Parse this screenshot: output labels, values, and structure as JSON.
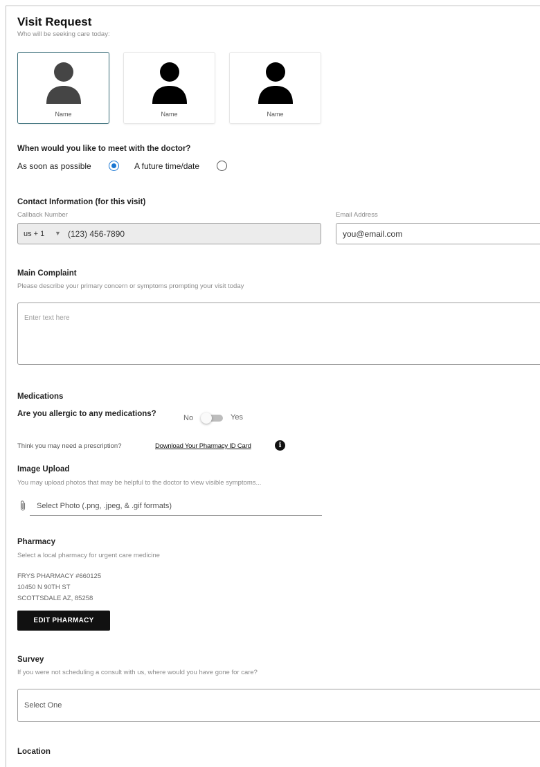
{
  "header": {
    "title": "Visit Request",
    "subtitle": "Who will be seeking care today:"
  },
  "patients": [
    {
      "name": "Name",
      "selected": true
    },
    {
      "name": "Name",
      "selected": false
    },
    {
      "name": "Name",
      "selected": false
    }
  ],
  "timing": {
    "question": "When would you like to meet with the doctor?",
    "option_asap": "As soon as possible",
    "option_future": "A future time/date",
    "selected": "asap"
  },
  "contact": {
    "heading": "Contact Information (for this visit)",
    "callback_label": "Callback Number",
    "country_code": "us + 1",
    "phone_value": "(123) 456-7890",
    "email_label": "Email Address",
    "email_value": "you@email.com"
  },
  "complaint": {
    "heading": "Main Complaint",
    "description": "Please describe your primary concern or symptoms prompting your visit today",
    "placeholder": "Enter text here"
  },
  "medications": {
    "heading": "Medications",
    "allergy_question": "Are you allergic to any medications?",
    "toggle_off_label": "No",
    "toggle_on_label": "Yes",
    "prescription_prompt": "Think you may need a prescription?",
    "pharmacy_card_link": "Download Your Pharmacy ID Card",
    "info_glyph": "i"
  },
  "image_upload": {
    "heading": "Image Upload",
    "description": "You may upload photos that may be helpful to the doctor to view visible symptoms...",
    "placeholder": "Select Photo (.png, .jpeg, & .gif formats)"
  },
  "pharmacy": {
    "heading": "Pharmacy",
    "description": "Select a local pharmacy for urgent care medicine",
    "name": "FRYS PHARMACY #660125",
    "street": "10450 N 90TH ST",
    "city_state_zip": "SCOTTSDALE AZ, 85258",
    "edit_button": "EDIT PHARMACY"
  },
  "survey": {
    "heading": "Survey",
    "question": "If you were not scheduling a consult with us, where would you have gone for care?",
    "select_value": "Select One"
  },
  "location": {
    "heading": "Location"
  },
  "colors": {
    "accent": "#1976d2",
    "selected_card_border": "#3a6e7a",
    "button_bg": "#111111"
  }
}
